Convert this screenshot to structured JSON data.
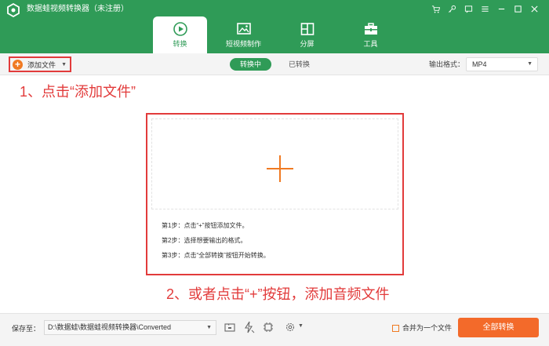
{
  "app": {
    "title": "数据蛙视频转换器（未注册）"
  },
  "tabs": [
    {
      "label": "转换",
      "icon": "convert-icon",
      "active": true
    },
    {
      "label": "短视频制作",
      "icon": "video-make-icon",
      "active": false
    },
    {
      "label": "分屏",
      "icon": "split-screen-icon",
      "active": false
    },
    {
      "label": "工具",
      "icon": "toolbox-icon",
      "active": false
    }
  ],
  "toolbar": {
    "add_file_label": "添加文件",
    "segments": {
      "converting": "转换中",
      "converted": "已转换"
    },
    "output_format_label": "输出格式：",
    "output_format_value": "MP4"
  },
  "annotations": {
    "step1": "1、点击“添加文件”",
    "step2": "2、或者点击“+”按钮，添加音频文件"
  },
  "drop_zone": {
    "steps": [
      "第1步：点击“+”按钮添加文件。",
      "第2步：选择想要输出的格式。",
      "第3步：点击“全部转换”按钮开始转换。"
    ]
  },
  "footer": {
    "save_to_label": "保存至：",
    "save_path": "D:\\数据蛙\\数据蛙视频转换器\\Converted",
    "merge_label": "合并为一个文件",
    "convert_all_label": "全部转换"
  },
  "colors": {
    "brand_green": "#2f9b57",
    "accent_orange": "#f36a2a",
    "annotation_red": "#e23b3b"
  }
}
